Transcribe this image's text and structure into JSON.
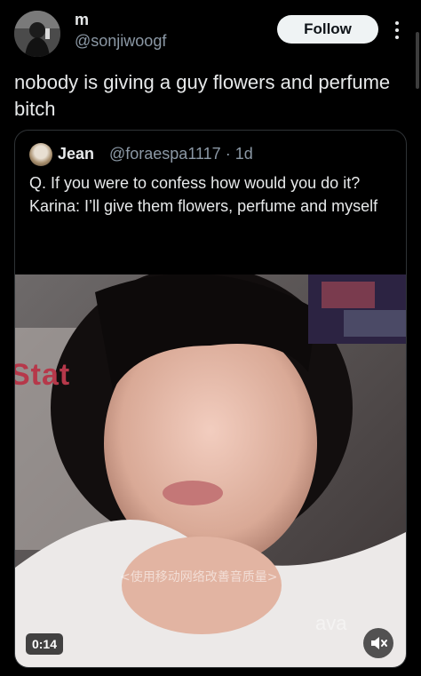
{
  "header": {
    "display_name": "m",
    "handle": "@sonjiwoogf",
    "follow_label": "Follow"
  },
  "tweet": {
    "text": "nobody is giving a guy flowers and perfume bitch"
  },
  "quote": {
    "name": "Jean",
    "handle_time": "@foraespa1117 · 1d",
    "text": "Q. If you were to confess how would you do it?\nKarina: I’ll give them flowers, perfume and myself"
  },
  "video": {
    "timestamp": "0:14",
    "watermark": "Stat",
    "subtitle_overlay": "<使用移动网络改善音质量>",
    "corner_text": "ava",
    "mute_icon": "speaker-muted-icon"
  }
}
